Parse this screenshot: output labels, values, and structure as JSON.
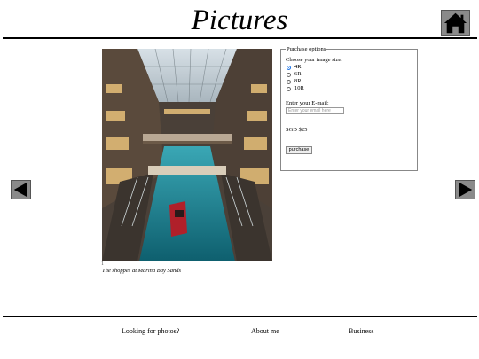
{
  "page": {
    "title": "Pictures"
  },
  "icons": {
    "home": "home-icon",
    "prev": "arrow-left-icon",
    "next": "arrow-right-icon"
  },
  "photo": {
    "caption": "The shoppes at Marina Bay Sands",
    "marker": "1"
  },
  "purchase": {
    "legend": "Purchase options",
    "size_label": "Choose your image size:",
    "sizes": [
      {
        "label": "4R",
        "checked": true
      },
      {
        "label": "6R",
        "checked": false
      },
      {
        "label": "8R",
        "checked": false
      },
      {
        "label": "10R",
        "checked": false
      }
    ],
    "email_label": "Enter your E-mail:",
    "email_placeholder": "Enter your email here",
    "email_value": "",
    "price": "SGD $25",
    "button_label": "purchase"
  },
  "footer": {
    "links": [
      "Looking for photos?",
      "About me",
      "Business"
    ]
  },
  "colors": {
    "button_bg": "#8a8a8a",
    "radio_checked": "#1a73e8"
  }
}
